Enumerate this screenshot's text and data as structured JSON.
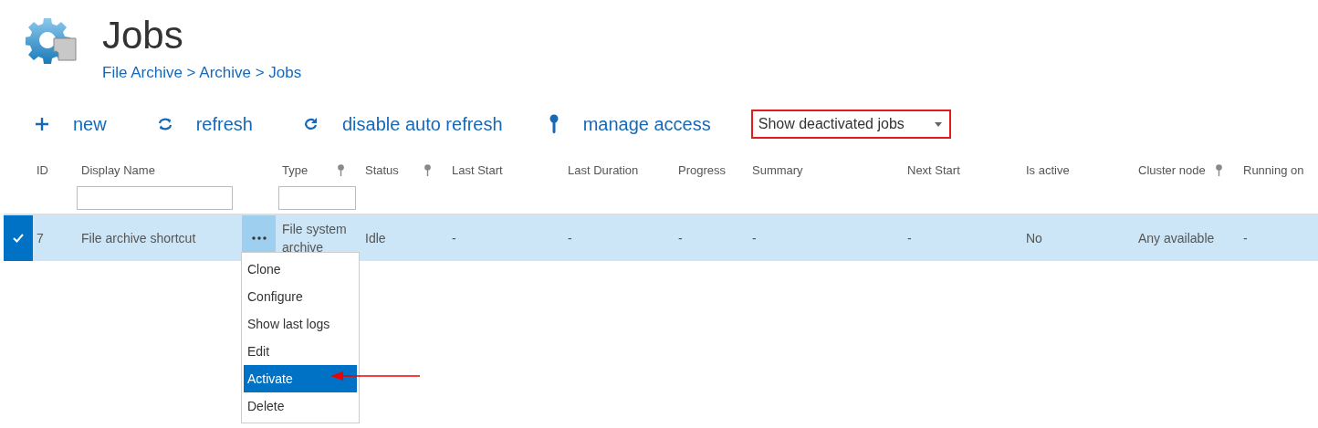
{
  "page": {
    "title": "Jobs",
    "breadcrumb": "File Archive > Archive > Jobs"
  },
  "toolbar": [
    {
      "kind": "new",
      "label": "new"
    },
    {
      "kind": "refresh",
      "label": "refresh"
    },
    {
      "kind": "auto_refresh",
      "label": "disable auto refresh"
    },
    {
      "kind": "access",
      "label": "manage access"
    }
  ],
  "filter_dropdown": {
    "value": "Show deactivated jobs",
    "highlighted": true
  },
  "table": {
    "columns": [
      {
        "label": "ID",
        "pin": false,
        "filter_field": false
      },
      {
        "label": "Display Name",
        "pin": false,
        "filter_field": true
      },
      {
        "label": "Type",
        "pin": true,
        "filter_field": true
      },
      {
        "label": "Status",
        "pin": true,
        "filter_field": false
      },
      {
        "label": "Last Start",
        "pin": false,
        "filter_field": false
      },
      {
        "label": "Last Duration",
        "pin": false,
        "filter_field": false
      },
      {
        "label": "Progress",
        "pin": false,
        "filter_field": false
      },
      {
        "label": "Summary",
        "pin": false,
        "filter_field": false
      },
      {
        "label": "Next Start",
        "pin": false,
        "filter_field": false
      },
      {
        "label": "Is active",
        "pin": false,
        "filter_field": false
      },
      {
        "label": "Cluster node",
        "pin": true,
        "filter_field": false
      },
      {
        "label": "Running on",
        "pin": false,
        "filter_field": false
      }
    ],
    "rows": [
      {
        "selected": true,
        "cells": [
          "7",
          "File archive shortcut",
          "File system archive",
          "Idle",
          "-",
          "-",
          "-",
          "-",
          "-",
          "No",
          "Any available",
          "-"
        ]
      }
    ]
  },
  "context_menu": {
    "items": [
      {
        "label": "Clone",
        "selected": false
      },
      {
        "label": "Configure",
        "selected": false
      },
      {
        "label": "Show last logs",
        "selected": false
      },
      {
        "label": "Edit",
        "selected": false
      },
      {
        "label": "Activate",
        "selected": true
      },
      {
        "label": "Delete",
        "selected": false
      }
    ]
  }
}
